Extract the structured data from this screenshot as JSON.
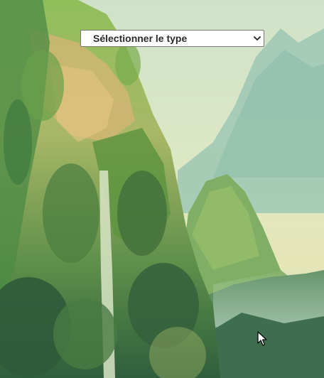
{
  "type_select": {
    "selected_label": "Sélectionner le type"
  },
  "icons": {
    "dropdown": "chevron-down-icon",
    "pointer": "mouse-cursor-icon"
  },
  "colors": {
    "select_background": "#ffffff",
    "select_border": "#7a7a7a",
    "select_text": "#2b2b2b"
  }
}
